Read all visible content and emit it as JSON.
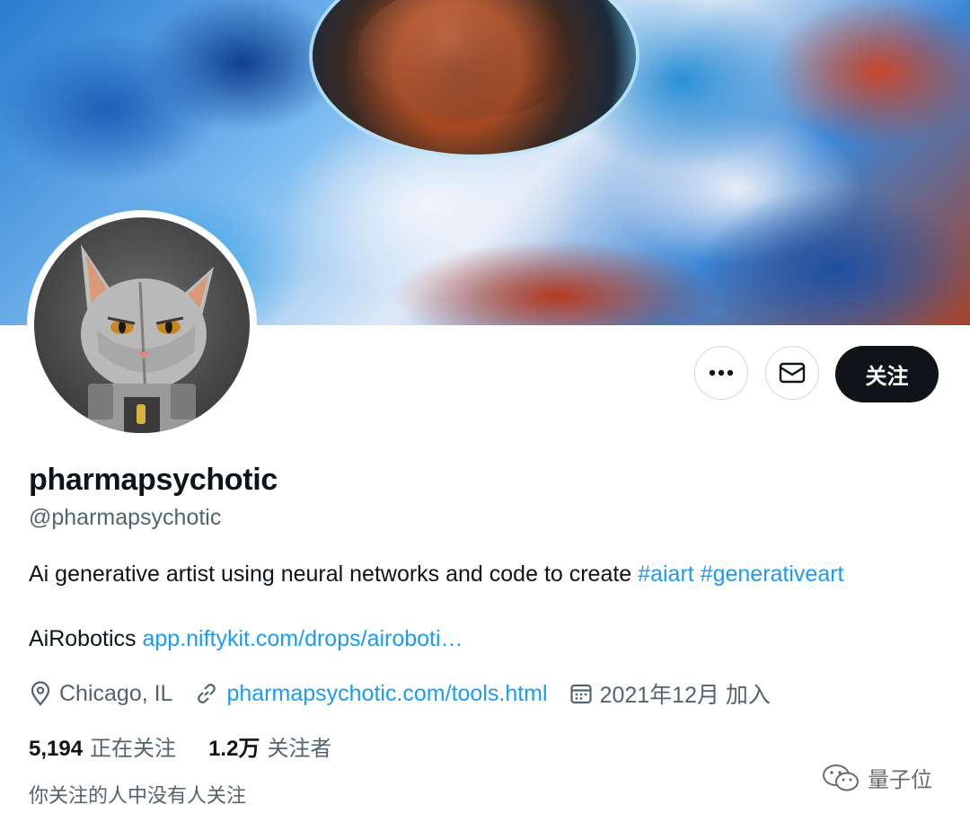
{
  "profile": {
    "display_name": "pharmapsychotic",
    "handle": "@pharmapsychotic",
    "bio_text": "Ai generative artist using neural networks and code to create ",
    "bio_hashtags": [
      "#aiart",
      "#generativeart"
    ],
    "bio_line2_text": "AiRobotics ",
    "bio_line2_link": "app.niftykit.com/drops/airoboti…",
    "location": "Chicago, IL",
    "website": "pharmapsychotic.com/tools.html",
    "joined": "2021年12月 加入",
    "following_count": "5,194",
    "following_label": "正在关注",
    "followers_count": "1.2万",
    "followers_label": "关注者",
    "followed_by_note": "你关注的人中没有人关注"
  },
  "actions": {
    "more_icon": "more-horizontal-icon",
    "message_icon": "envelope-icon",
    "follow_label": "关注"
  },
  "watermark": {
    "text": "量子位",
    "icon": "wechat-icon"
  },
  "colors": {
    "link": "#1d9bf0",
    "text_primary": "#0f1419",
    "text_secondary": "#536471",
    "button_dark": "#0f1419"
  }
}
